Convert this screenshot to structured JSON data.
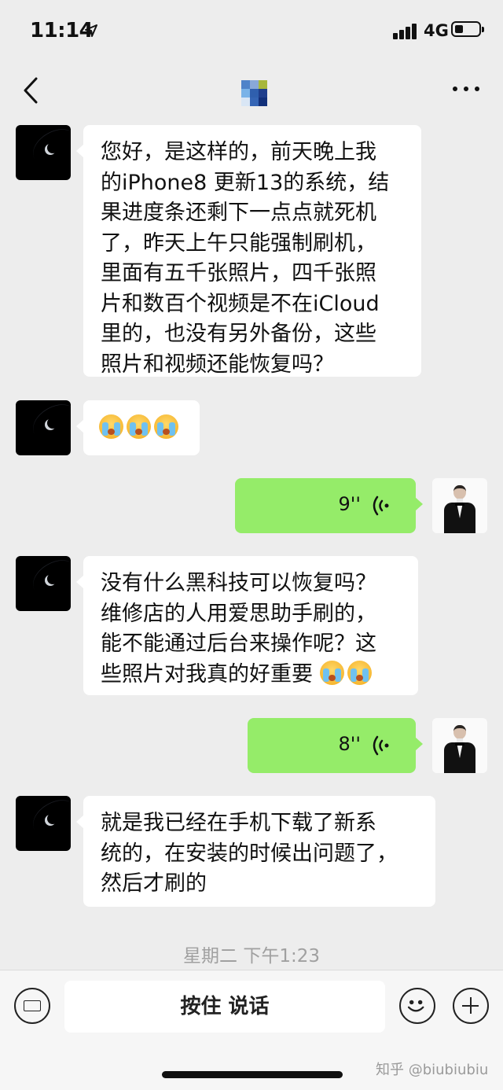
{
  "status": {
    "time": "11:14",
    "network": "4G"
  },
  "messages": {
    "m1": [
      "您好，是这样的，前天晚上我",
      "的iPhone8 更新13的系统，结",
      "果进度条还剩下一点点就死机",
      "了，昨天上午只能强制刷机，",
      "里面有五千张照片，四千张照",
      "片和数百个视频是不在iCloud",
      "里的，也没有另外备份，这些",
      "照片和视频还能恢复吗？"
    ],
    "m3_duration": "9''",
    "m4": [
      "没有什么黑科技可以恢复吗？",
      "维修店的人用爱思助手刷的，",
      "能不能通过后台来操作呢？这",
      "些照片对我真的好重要"
    ],
    "m5_duration": "8''",
    "m6": [
      "就是我已经在手机下载了新系",
      "统的，在安装的时候出问题了，",
      "然后才刷的"
    ]
  },
  "timestamp": "星期二 下午1:23",
  "input": {
    "hold_to_talk": "按住 说话"
  },
  "watermark": "知乎 @biubiubiu",
  "colors": {
    "incoming": "#ffffff",
    "outgoing": "#95ec69",
    "background": "#ededed"
  }
}
